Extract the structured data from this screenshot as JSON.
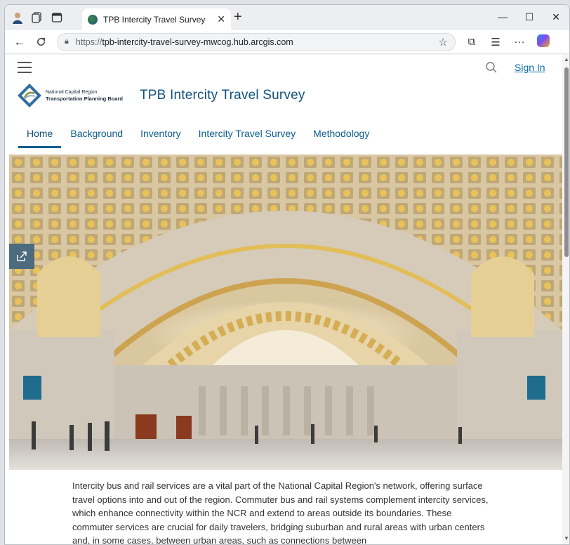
{
  "browser": {
    "tab_title": "TPB Intercity Travel Survey",
    "url_prefix": "https://",
    "url_host": "tpb-intercity-travel-survey-mwcog.hub.arcgis.com"
  },
  "header": {
    "org_line1": "National Capital Region",
    "org_line2": "Transportation Planning Board",
    "site_title": "TPB Intercity Travel Survey",
    "sign_in": "Sign In"
  },
  "nav": {
    "items": [
      {
        "label": "Home"
      },
      {
        "label": "Background"
      },
      {
        "label": "Inventory"
      },
      {
        "label": "Intercity Travel Survey"
      },
      {
        "label": "Methodology"
      }
    ]
  },
  "content": {
    "intro": "Intercity bus and rail services are a vital part of the National Capital Region's network, offering surface travel options into and out of the region. Commuter bus and rail systems complement intercity services, which enhance connectivity within the NCR and extend to areas outside its boundaries. These commuter services are crucial for daily travelers, bridging suburban and rural areas with urban centers and, in some cases, between urban areas, such as connections between"
  },
  "colors": {
    "brand_blue": "#10517d",
    "link_blue": "#0b6bab",
    "share_button": "#4d6b7e"
  },
  "icons": {
    "hamburger": "menu-icon",
    "search": "search-icon",
    "share": "share-icon"
  }
}
